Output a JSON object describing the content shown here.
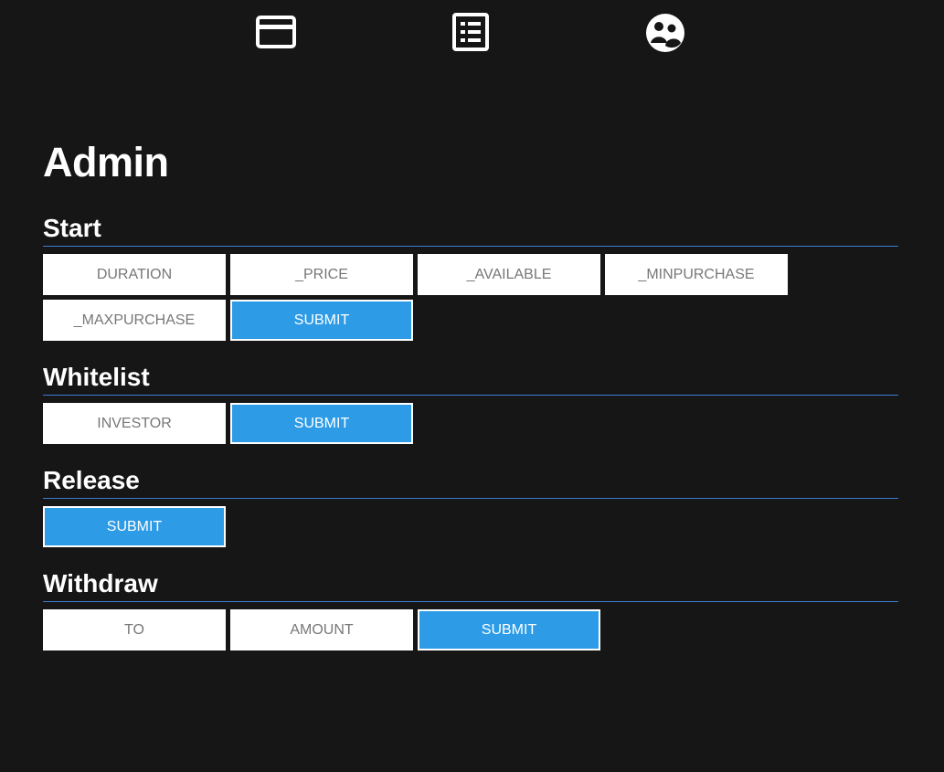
{
  "nav": {
    "items": [
      {
        "icon": "credit-card-icon"
      },
      {
        "icon": "list-icon"
      },
      {
        "icon": "users-icon"
      }
    ]
  },
  "page_title": "Admin",
  "sections": {
    "start": {
      "title": "Start",
      "fields": {
        "duration": "DURATION",
        "price": "_PRICE",
        "available": "_AVAILABLE",
        "minpurchase": "_MINPURCHASE",
        "maxpurchase": "_MAXPURCHASE"
      },
      "submit_label": "SUBMIT"
    },
    "whitelist": {
      "title": "Whitelist",
      "fields": {
        "investor": "INVESTOR"
      },
      "submit_label": "SUBMIT"
    },
    "release": {
      "title": "Release",
      "submit_label": "SUBMIT"
    },
    "withdraw": {
      "title": "Withdraw",
      "fields": {
        "to": "TO",
        "amount": "AMOUNT"
      },
      "submit_label": "SUBMIT"
    }
  },
  "colors": {
    "background": "#161616",
    "accent": "#2d9be6",
    "divider": "#3a7bd5"
  }
}
